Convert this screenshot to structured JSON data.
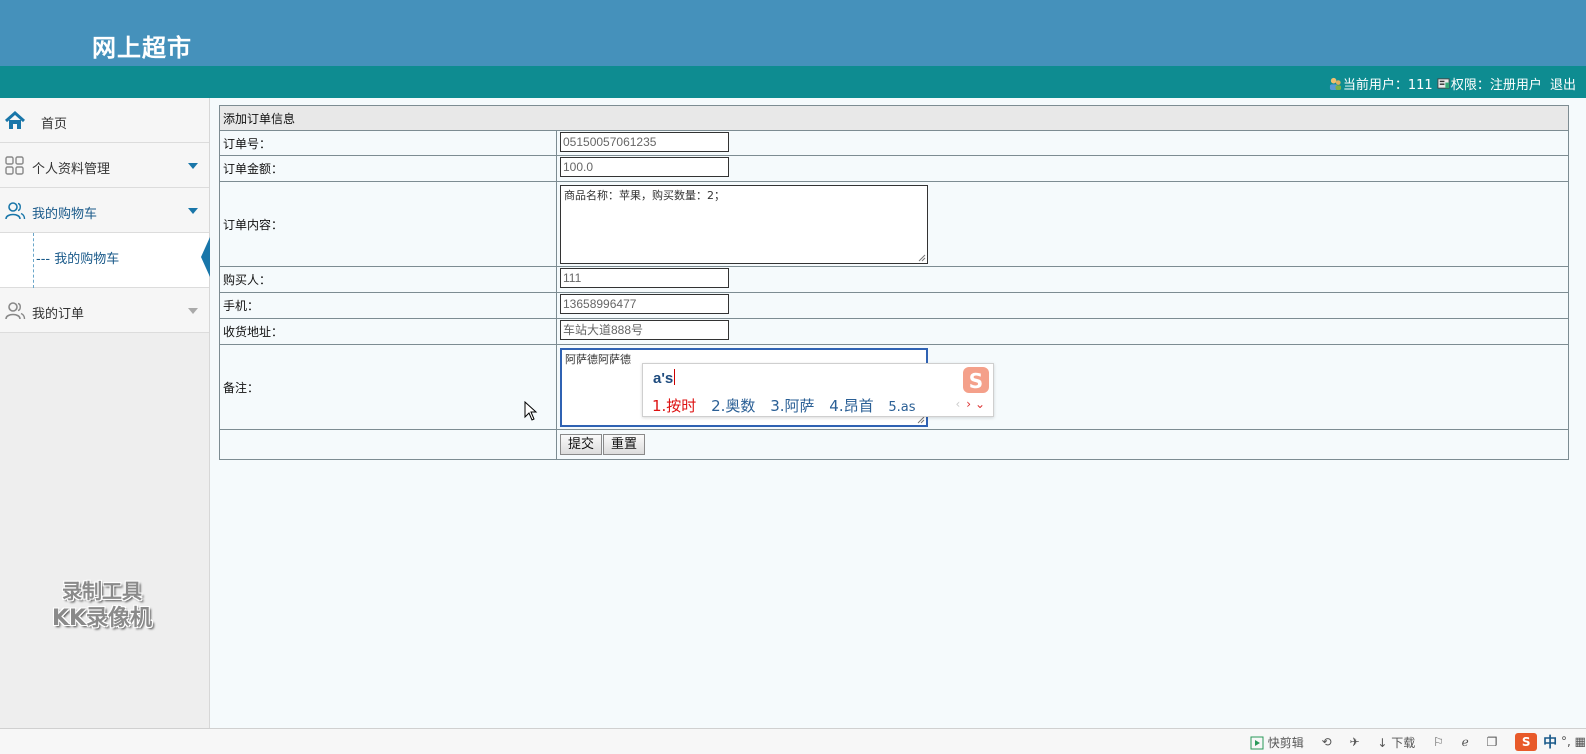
{
  "header": {
    "site_title": "网上超市"
  },
  "userbar": {
    "current_user_label": "当前用户：",
    "current_user": "111",
    "role_label": "权限：",
    "role": "注册用户",
    "logout": "退出"
  },
  "sidebar": {
    "home": "首页",
    "profile": "个人资料管理",
    "cart": "我的购物车",
    "cart_sub": "--- 我的购物车",
    "orders": "我的订单"
  },
  "form": {
    "title": "添加订单信息",
    "order_no_label": "订单号：",
    "order_no": "05150057061235",
    "amount_label": "订单金额：",
    "amount": "100.0",
    "content_label": "订单内容：",
    "content": "商品名称：苹果，购买数量：2；",
    "buyer_label": "购买人：",
    "buyer": "111",
    "phone_label": "手机：",
    "phone": "13658996477",
    "address_label": "收货地址：",
    "address": "车站大道888号",
    "remark_label": "备注：",
    "remark": "阿萨德阿萨德",
    "submit": "提交",
    "reset": "重置"
  },
  "ime": {
    "composition": "a's",
    "candidates": [
      "1.按时",
      "2.奥数",
      "3.阿萨",
      "4.昂首",
      "5.as"
    ],
    "prev": "‹",
    "next": "›",
    "more": "⌄"
  },
  "watermark": {
    "line1": "录制工具",
    "line2": "KK录像机"
  },
  "statusbar": {
    "quick_clip": "快剪辑",
    "download": "下载",
    "ime_lang": "中"
  },
  "colors": {
    "banner": "#4591bb",
    "userbar": "#0e8c91",
    "link_blue": "#1976a9",
    "ime_first": "#dd1111"
  }
}
